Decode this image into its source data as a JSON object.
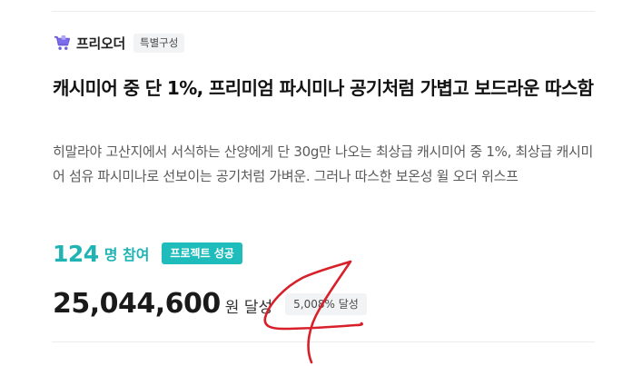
{
  "shop": {
    "name": "프리오더",
    "tag": "특별구성"
  },
  "title": "캐시미어 중 단 1%, 프리미엄 파시미나 공기처럼 가볍고 보드라운 따스함",
  "description": "히말라야 고산지에서 서식하는 산양에게 단 30g만 나오는 최상급 캐시미어 중 1%, 최상급 캐시미어 섬유 파시미나로 선보이는 공기처럼 가벼운. 그러나 따스한 보온성 윌 오더 위스프",
  "participants": {
    "count": "124",
    "unit": "명 참여",
    "status": "프로젝트 성공"
  },
  "funding": {
    "amount": "25,044,600",
    "unit": "원 달성",
    "rate": "5,008% 달성"
  },
  "colors": {
    "accent": "#1fb3b3",
    "badge": "#1fbcbc",
    "annotation": "#d8202a"
  },
  "icons": {
    "shop": "shopping-cart-icon"
  }
}
